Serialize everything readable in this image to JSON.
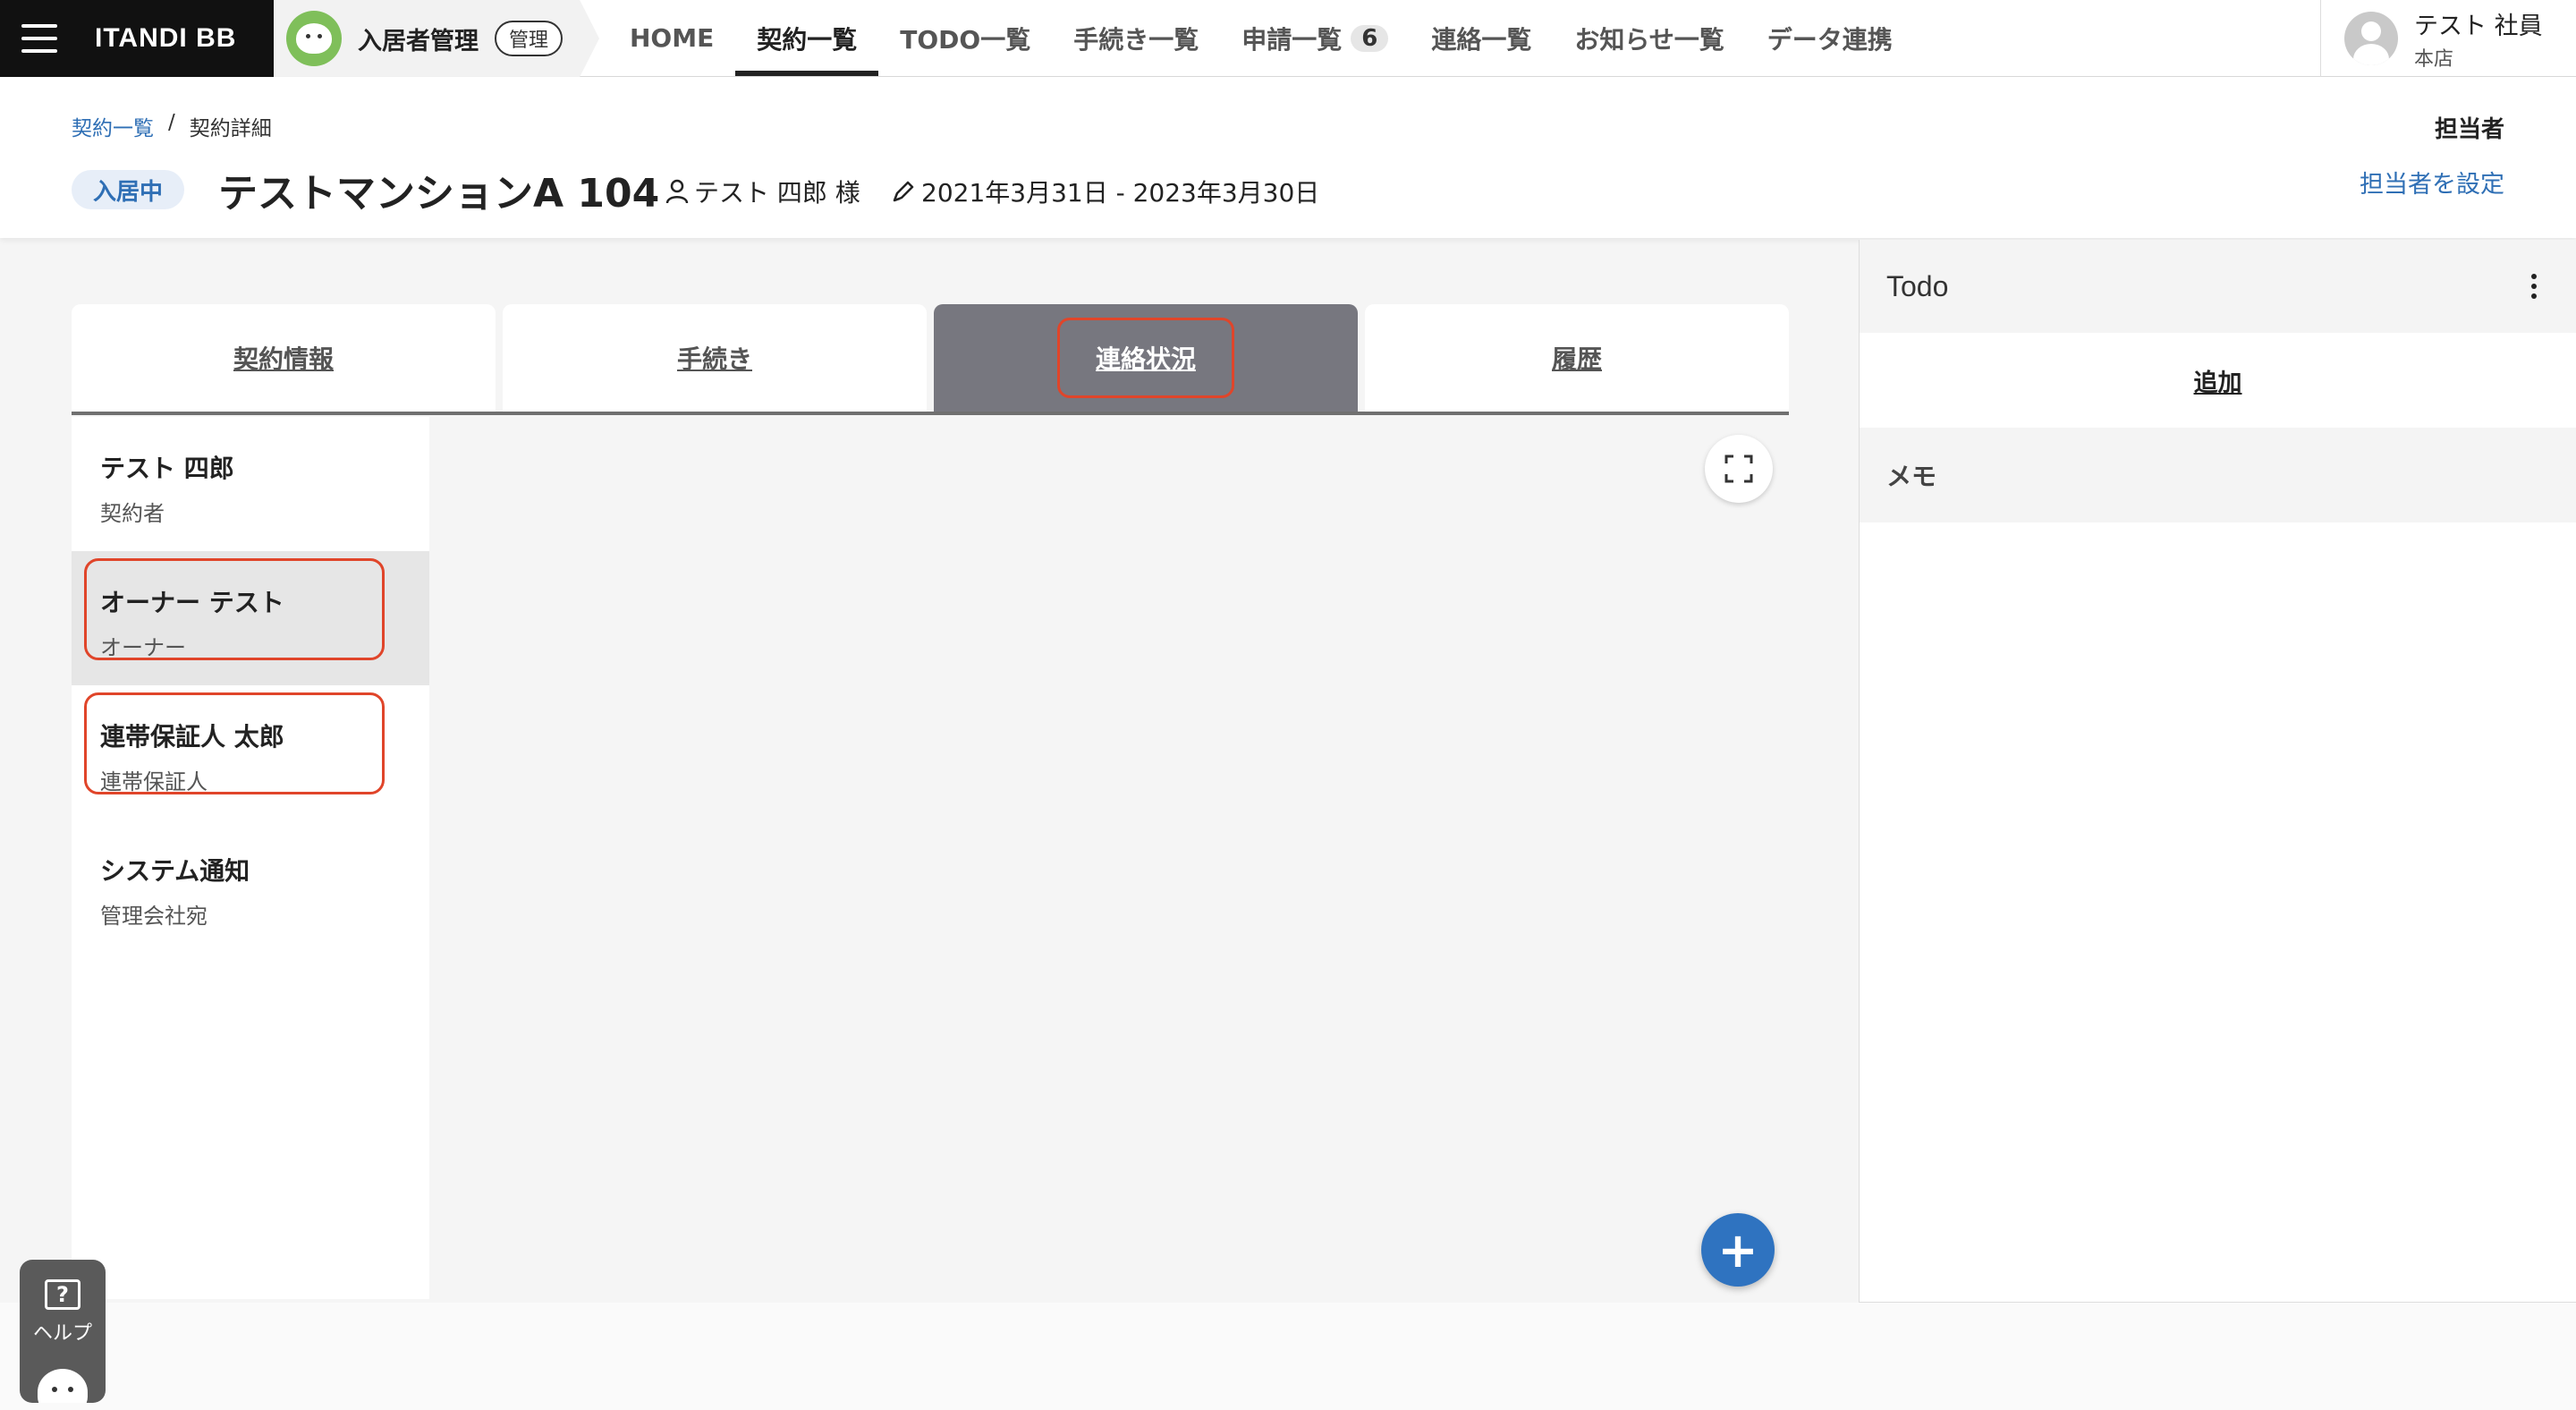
{
  "brand": {
    "name": "ITANDI BB"
  },
  "product": {
    "name": "入居者管理",
    "badge": "管理"
  },
  "nav": {
    "items": [
      {
        "label": "HOME"
      },
      {
        "label": "契約一覧",
        "active": true
      },
      {
        "label": "TODO一覧"
      },
      {
        "label": "手続き一覧"
      },
      {
        "label": "申請一覧",
        "count": "6"
      },
      {
        "label": "連絡一覧"
      },
      {
        "label": "お知らせ一覧"
      },
      {
        "label": "データ連携"
      }
    ]
  },
  "user": {
    "name": "テスト 社員",
    "branch": "本店"
  },
  "breadcrumb": {
    "parent": "契約一覧",
    "separator": "/",
    "current": "契約詳細"
  },
  "contract": {
    "status": "入居中",
    "title": "テストマンションA 104",
    "person": "テスト 四郎 様",
    "period": "2021年3月31日 - 2023年3月30日"
  },
  "assignee": {
    "label": "担当者",
    "link": "担当者を設定"
  },
  "tabs": [
    {
      "label": "契約情報"
    },
    {
      "label": "手続き"
    },
    {
      "label": "連絡状況",
      "active": true
    },
    {
      "label": "履歴"
    }
  ],
  "contacts": [
    {
      "name": "テスト 四郎",
      "role": "契約者"
    },
    {
      "name": "オーナー テスト",
      "role": "オーナー",
      "selected": true
    },
    {
      "name": "連帯保証人 太郎",
      "role": "連帯保証人"
    },
    {
      "name": "システム通知",
      "role": "管理会社宛"
    }
  ],
  "sidebar": {
    "todo_title": "Todo",
    "add_label": "追加",
    "memo_label": "メモ"
  },
  "help": {
    "icon_glyph": "?",
    "label": "ヘルプ"
  },
  "fab": {
    "glyph": "+"
  },
  "colors": {
    "accent": "#2f73c0",
    "highlight": "#e0452a",
    "active_tab": "#77777f"
  },
  "icons": [
    "menu-icon",
    "person-icon",
    "pen-icon",
    "fullscreen-icon",
    "kebab-icon",
    "plus-icon",
    "help-icon"
  ]
}
